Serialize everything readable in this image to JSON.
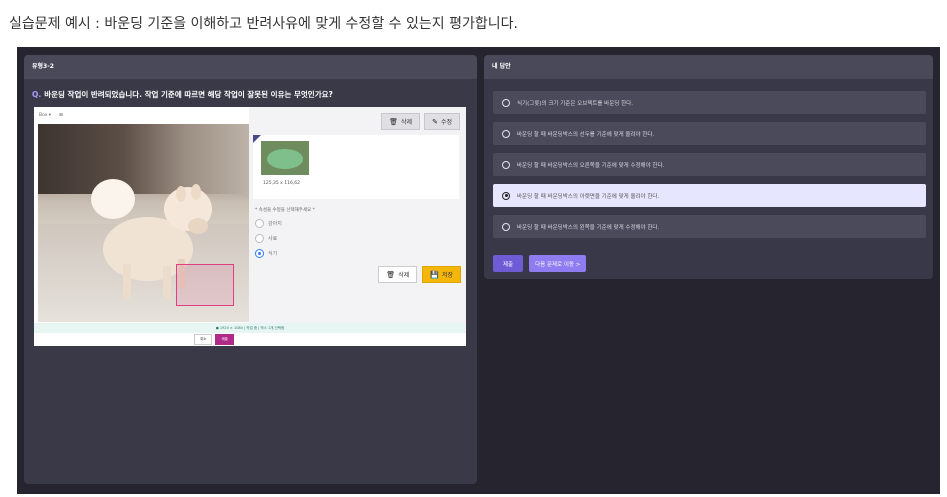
{
  "page": {
    "caption": "실습문제 예시 : 바운딩 기준을 이해하고 반려사유에 맞게 수정할 수 있는지 평가합니다."
  },
  "left_panel": {
    "header": "유형3-2",
    "question_mark": "Q.",
    "question": "바운딩 작업이 반려되었습니다. 작업 기준에 따르면 해당 작업이 잘못된 이유는 무엇인가요?"
  },
  "editor": {
    "toolbar_select": "Box ▾",
    "toolbar_icon": "⊞",
    "top_buttons": {
      "delete": "삭제",
      "edit": "수정"
    },
    "card_coords": "125,35 x 116,62",
    "form_label": "* 속성을 수정을 선택해주세요 *",
    "radio_options": [
      {
        "label": "강아지",
        "checked": false
      },
      {
        "label": "사료",
        "checked": false
      },
      {
        "label": "식기",
        "checked": true
      }
    ],
    "bottom_buttons": {
      "delete": "삭제",
      "save": "저장"
    },
    "status_bar": "● 1920 × 1080 | 작업 중 | 박스 1개 선택됨",
    "mini_buttons": {
      "cancel": "취소",
      "submit": "제출"
    }
  },
  "right_panel": {
    "header": "내 답안",
    "answers": [
      {
        "text": "식기(그릇)의 크기 기준은 오브젝트를 바운딩 한다.",
        "selected": false
      },
      {
        "text": "바운딩 할 때 바운딩박스의 선두를 기준에 맞게 올려야 한다.",
        "selected": false
      },
      {
        "text": "바운딩 할 때 바운딩박스의 오른쪽을 기준에 맞게 수정해야 한다.",
        "selected": false
      },
      {
        "text": "바운딩 할 때 바운딩박스의 아랫면을 기준에 맞게 올려야 한다.",
        "selected": true
      },
      {
        "text": "바운딩 할 때 바운딩박스의 왼쪽을 기준에 맞게 수정해야 한다.",
        "selected": false
      }
    ],
    "submit_label": "제출",
    "next_label": "다음 문제로 이동 >"
  }
}
